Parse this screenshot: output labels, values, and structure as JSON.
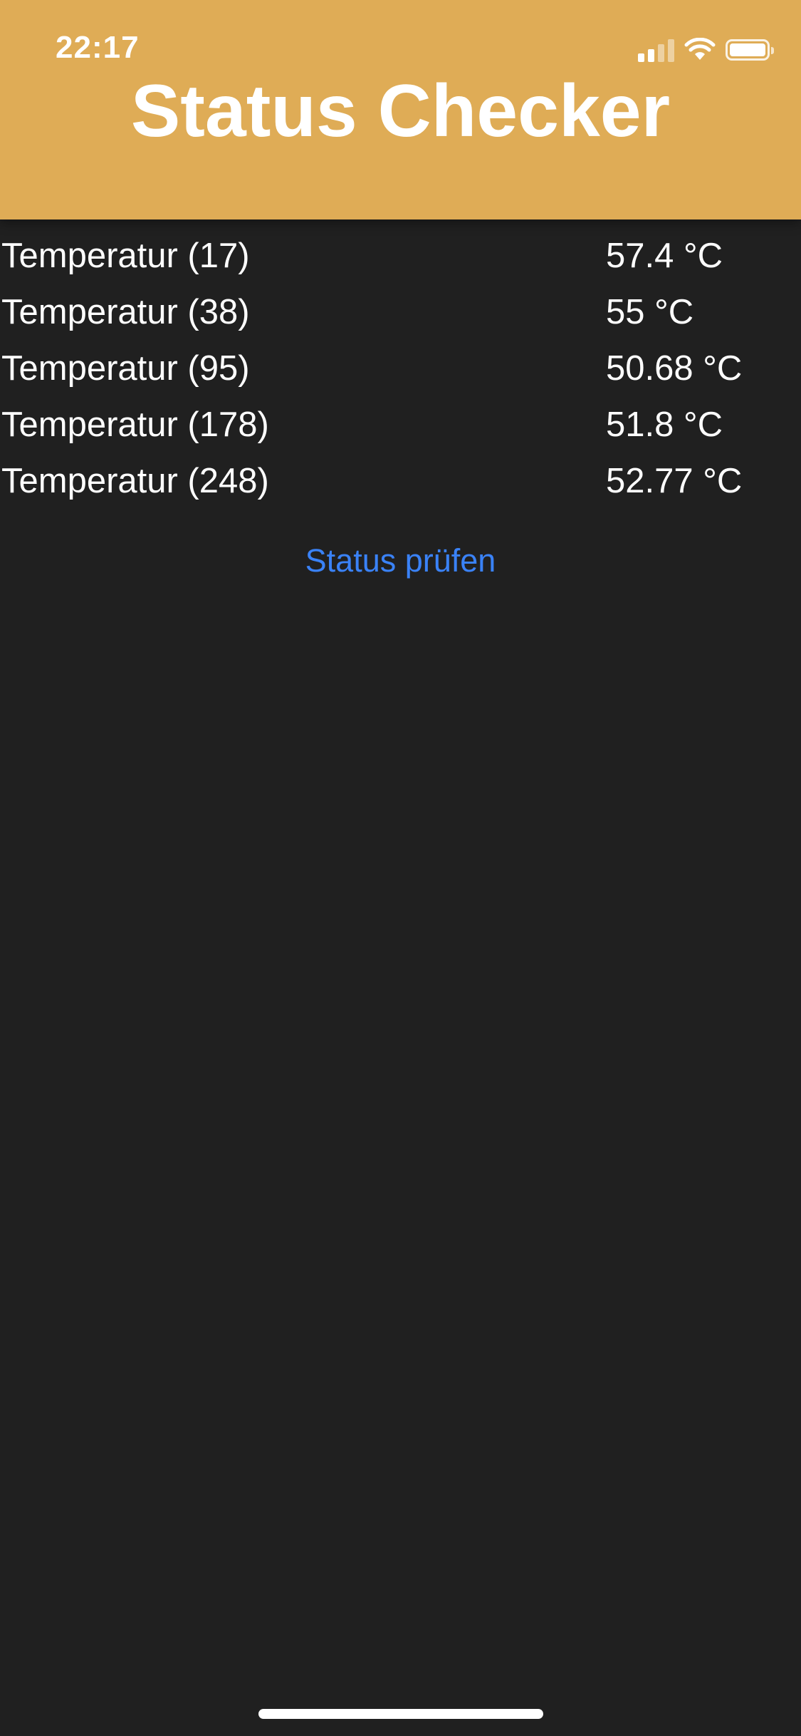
{
  "status_bar": {
    "time": "22:17"
  },
  "header": {
    "title": "Status Checker",
    "background_color": "#dfac56"
  },
  "readings": [
    {
      "label": "Temperatur (17)",
      "value": "57.4 °C"
    },
    {
      "label": "Temperatur (38)",
      "value": "55 °C"
    },
    {
      "label": "Temperatur (95)",
      "value": "50.68 °C"
    },
    {
      "label": "Temperatur (178)",
      "value": "51.8 °C"
    },
    {
      "label": "Temperatur (248)",
      "value": "52.77 °C"
    }
  ],
  "actions": {
    "check_label": "Status prüfen",
    "check_color": "#3a82f7"
  }
}
